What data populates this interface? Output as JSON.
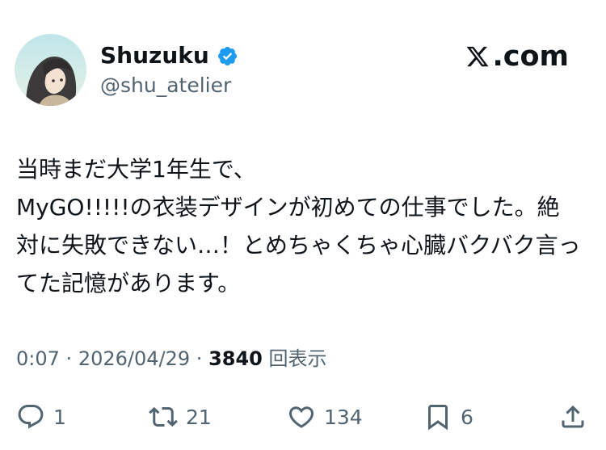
{
  "tweet": {
    "author": {
      "display_name": "Shuzuku",
      "handle": "@shu_atelier",
      "verified_icon": "verified-badge-icon",
      "avatar": "avatar-illustration"
    },
    "site_label": ".com",
    "text": "当時まだ大学1年生で、\nMyGO!!!!!の衣装デザインが初めての仕事でした。絶対に失敗できない…！とめちゃくちゃ心臓バクバク言ってた記憶があります。",
    "time": "0:07",
    "separator": "·",
    "date": "2026/04/29",
    "views_count": "3840",
    "views_label": "回表示",
    "actions": {
      "reply_count": "1",
      "repost_count": "21",
      "like_count": "134",
      "bookmark_count": "6"
    }
  },
  "colors": {
    "text_primary": "#0f1419",
    "text_secondary": "#536471",
    "verified_blue": "#1d9bf0"
  }
}
